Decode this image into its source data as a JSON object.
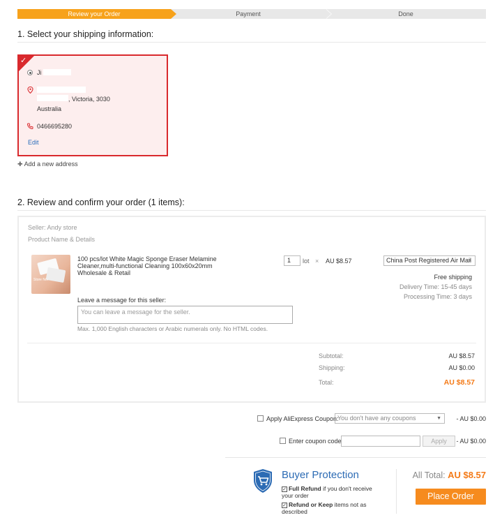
{
  "steps": [
    "Review your Order",
    "Payment",
    "Done"
  ],
  "section1_title": "1. Select your shipping information:",
  "address": {
    "name": "Ji",
    "street_line": ", Victoria, 3030",
    "country": "Australia",
    "phone": "0466695280",
    "edit_label": "Edit"
  },
  "add_address_label": "Add a new address",
  "section2_title": "2. Review and confirm your order (1 items):",
  "order": {
    "seller": "Seller: Andy store",
    "product_header": "Product Name & Details",
    "product_title": "100 pcs/lot White Magic Sponge Eraser Melamine Cleaner,multi-functional Cleaning 100x60x20mm Wholesale & Retail",
    "quantity": "1",
    "quantity_unit": "lot",
    "times_sign": "×",
    "unit_price": "AU $8.57",
    "shipping_method": "China Post Registered Air Mail",
    "free_shipping": "Free shipping",
    "delivery_time": "Delivery Time:  15-45 days",
    "processing_time": "Processing Time:  3 days",
    "message_label": "Leave a message for this seller:",
    "message_placeholder": "You can leave a message for the seller.",
    "message_hint": "Max. 1,000 English characters or Arabic numerals only. No HTML codes.",
    "subtotal_label": "Subtotal:",
    "subtotal_value": "AU $8.57",
    "shipping_label": "Shipping:",
    "shipping_value": "AU $0.00",
    "total_label": "Total:",
    "total_value": "AU $8.57"
  },
  "coupons": {
    "ali_label": "Apply AliExpress Coupon:",
    "ali_select": "You don't have any coupons",
    "ali_discount": "- AU $0.00",
    "code_label": "Enter coupon code:",
    "apply_label": "Apply",
    "code_discount": "- AU $0.00"
  },
  "buyer_protection": {
    "title": "Buyer Protection",
    "item1_bold": "Full Refund",
    "item1_rest": " if you don't receive your order",
    "item2_bold": "Refund or Keep",
    "item2_rest": " items not as described"
  },
  "all_total_label": "All Total:",
  "all_total_value": "AU $8.57",
  "place_order_label": "Place Order",
  "colors": {
    "accent_orange": "#f7a21b",
    "price_orange": "#f47a17",
    "selected_red": "#d9292d",
    "link_blue": "#2a6ebb"
  }
}
